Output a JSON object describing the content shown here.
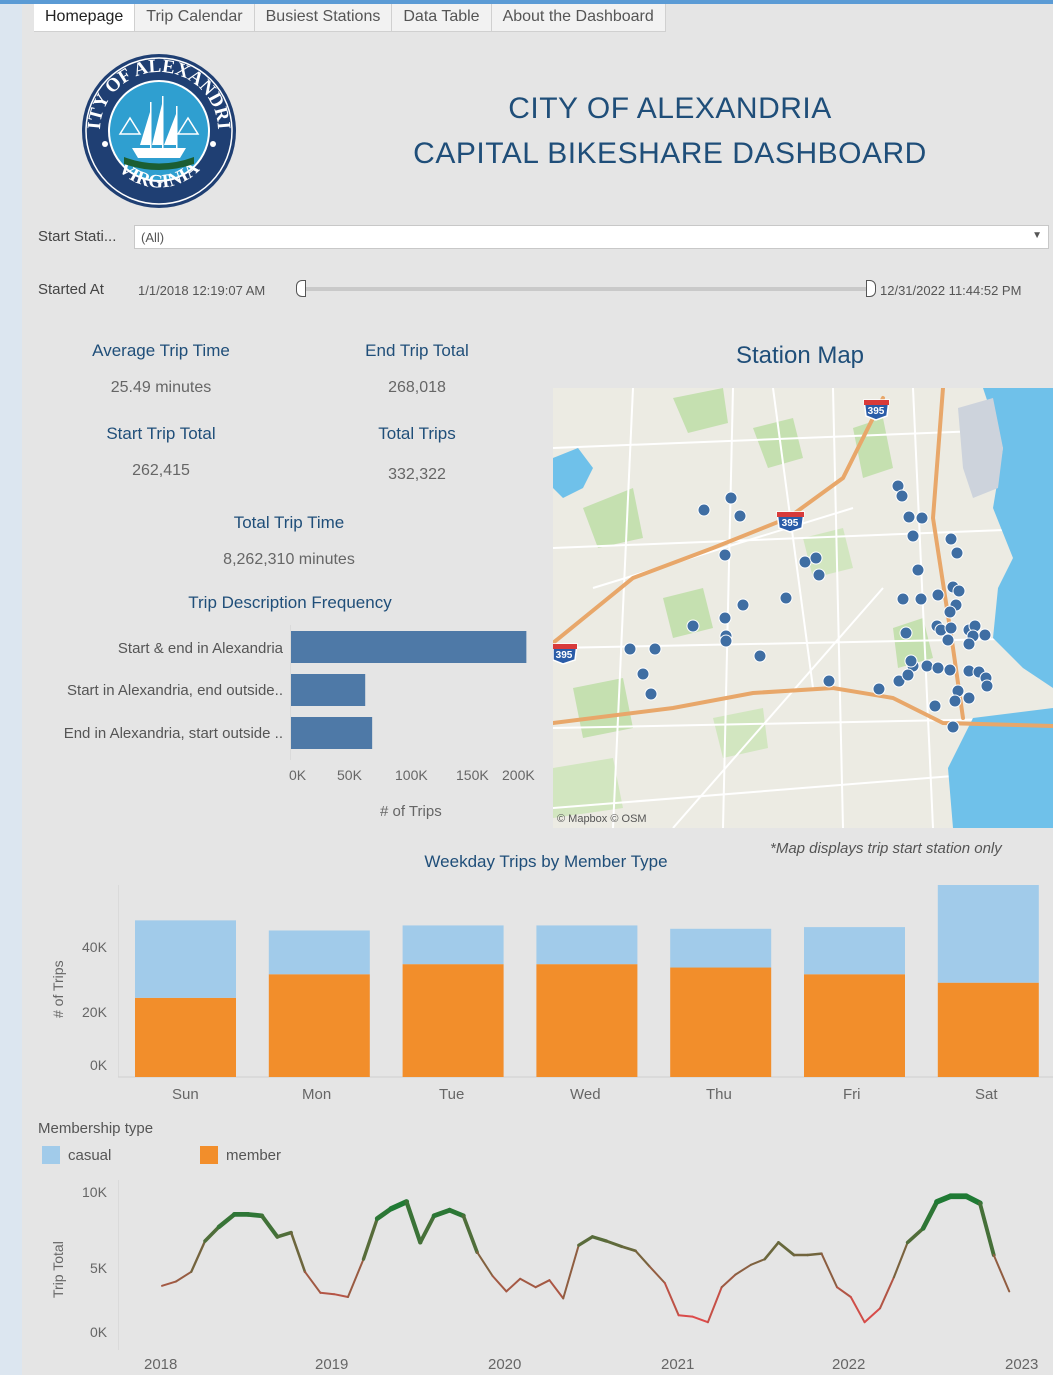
{
  "tabs": [
    "Homepage",
    "Trip Calendar",
    "Busiest Stations",
    "Data Table",
    "About the Dashboard"
  ],
  "title": {
    "line1": "CITY OF ALEXANDRIA",
    "line2": "CAPITAL BIKESHARE DASHBOARD"
  },
  "seal": {
    "text_top": "CITY OF ALEXANDRIA",
    "text_bottom": "VIRGINIA"
  },
  "filters": {
    "start_station_label": "Start Stati...",
    "start_station_value": "(All)",
    "started_at_label": "Started At",
    "range_start": "1/1/2018 12:19:07 AM",
    "range_end": "12/31/2022 11:44:52 PM"
  },
  "kpis": {
    "avg_trip_time_label": "Average Trip Time",
    "avg_trip_time_value": "25.49 minutes",
    "end_trip_total_label": "End Trip Total",
    "end_trip_total_value": "268,018",
    "start_trip_total_label": "Start Trip Total",
    "start_trip_total_value": "262,415",
    "total_trips_label": "Total Trips",
    "total_trips_value": "332,322",
    "total_trip_time_label": "Total Trip Time",
    "total_trip_time_value": "8,262,310 minutes"
  },
  "map": {
    "title": "Station Map",
    "attribution": "© Mapbox  © OSM",
    "note": "*Map displays trip start station only",
    "shield_1": "395",
    "shield_2": "395",
    "shield_3": "395"
  },
  "colors": {
    "casual": "#a1cbea",
    "member": "#f28e2b",
    "desc_bar": "#4e79a7",
    "title": "#1f4e79"
  },
  "chart_data": [
    {
      "type": "bar",
      "title": "Trip Description Frequency",
      "orientation": "horizontal",
      "categories": [
        "Start & end in Alexandria",
        "Start in Alexandria, end outside..",
        "End in Alexandria, start outside .."
      ],
      "values": [
        203000,
        64000,
        70000
      ],
      "xlabel": "# of Trips",
      "xticks": [
        "0K",
        "50K",
        "100K",
        "150K",
        "200K"
      ],
      "xlim": [
        0,
        207000
      ]
    },
    {
      "type": "bar",
      "title": "Weekday Trips by Member Type",
      "stacked": true,
      "categories": [
        "Sun",
        "Mon",
        "Tue",
        "Wed",
        "Thu",
        "Fri",
        "Sat"
      ],
      "series": [
        {
          "name": "member",
          "values": [
            23500,
            30500,
            33500,
            33500,
            32500,
            30500,
            28000
          ]
        },
        {
          "name": "casual",
          "values": [
            23000,
            13000,
            11500,
            11500,
            11500,
            14000,
            29000
          ]
        }
      ],
      "ylabel": "# of Trips",
      "yticks": [
        "0K",
        "20K",
        "40K"
      ],
      "ylim": [
        0,
        57000
      ],
      "legend_title": "Membership type"
    },
    {
      "type": "line",
      "ylabel": "Trip Total",
      "yticks": [
        "0K",
        "5K",
        "10K"
      ],
      "ylim": [
        0,
        10000
      ],
      "xticks": [
        "2018",
        "2019",
        "2020",
        "2021",
        "2022",
        "2023"
      ],
      "xlim": [
        2018,
        2023
      ],
      "x": [
        2018.0,
        2018.08,
        2018.17,
        2018.25,
        2018.33,
        2018.42,
        2018.5,
        2018.58,
        2018.67,
        2018.75,
        2018.83,
        2018.92,
        2019.0,
        2019.08,
        2019.17,
        2019.25,
        2019.33,
        2019.42,
        2019.5,
        2019.58,
        2019.67,
        2019.75,
        2019.83,
        2019.92,
        2020.0,
        2020.08,
        2020.17,
        2020.25,
        2020.33,
        2020.42,
        2020.5,
        2020.58,
        2020.67,
        2020.75,
        2020.83,
        2020.92,
        2021.0,
        2021.08,
        2021.17,
        2021.25,
        2021.33,
        2021.42,
        2021.5,
        2021.58,
        2021.67,
        2021.75,
        2021.83,
        2021.92,
        2022.0,
        2022.08,
        2022.17,
        2022.25,
        2022.33,
        2022.42,
        2022.5,
        2022.58,
        2022.67,
        2022.75,
        2022.83,
        2022.92
      ],
      "values": [
        3300,
        3600,
        4300,
        6500,
        7500,
        8400,
        8400,
        8300,
        6800,
        7100,
        4300,
        2800,
        2700,
        2500,
        5200,
        8100,
        8800,
        9300,
        6400,
        8300,
        8700,
        8300,
        5700,
        4000,
        2900,
        3800,
        3200,
        3700,
        2400,
        6200,
        6800,
        6500,
        6100,
        5800,
        4700,
        3500,
        1200,
        1100,
        700,
        3200,
        4100,
        4800,
        5200,
        6400,
        5500,
        5500,
        5600,
        3200,
        2500,
        700,
        1700,
        3900,
        6400,
        7400,
        9300,
        9700,
        9700,
        9200,
        5500,
        2900
      ]
    }
  ]
}
